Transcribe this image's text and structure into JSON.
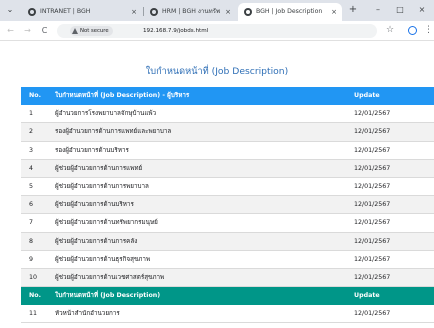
{
  "browser": {
    "tabs": [
      {
        "title": "INTRANET | BGH",
        "close": "×"
      },
      {
        "title": "HRM | BGH งานทรัพยากรมนุษย์",
        "close": "×"
      },
      {
        "title": "BGH | Job Description",
        "close": "×"
      }
    ],
    "new_tab": "+",
    "window_controls": {
      "minimize": "–",
      "maximize": "□",
      "close": "×"
    },
    "nav": {
      "back": "←",
      "forward": "→",
      "reload": "C"
    },
    "security_label": "Not secure",
    "url": "192.168.7.9/jobds.html",
    "star": "☆",
    "menu": "⋮"
  },
  "page": {
    "title": "ใบกำหนดหน้าที่ (Job Description)",
    "sections": [
      {
        "header": {
          "no": "No.",
          "title": "ใบกำหนดหน้าที่ (Job Description) - ผู้บริหาร",
          "update": "Update"
        },
        "rows": [
          {
            "no": "1",
            "title": "ผู้อำนวยการโรงพยาบาลจักษุบ้านแพ้ว",
            "update": "12/01/2567"
          },
          {
            "no": "2",
            "title": "รองผู้อำนวยการด้านการแพทย์และพยาบาล",
            "update": "12/01/2567"
          },
          {
            "no": "3",
            "title": "รองผู้อำนวยการด้านบริหาร",
            "update": "12/01/2567"
          },
          {
            "no": "4",
            "title": "ผู้ช่วยผู้อำนวยการด้านการแพทย์",
            "update": "12/01/2567"
          },
          {
            "no": "5",
            "title": "ผู้ช่วยผู้อำนวยการด้านการพยาบาล",
            "update": "12/01/2567"
          },
          {
            "no": "6",
            "title": "ผู้ช่วยผู้อำนวยการด้านบริหาร",
            "update": "12/01/2567"
          },
          {
            "no": "7",
            "title": "ผู้ช่วยผู้อำนวยการด้านทรัพยากรมนุษย์",
            "update": "12/01/2567"
          },
          {
            "no": "8",
            "title": "ผู้ช่วยผู้อำนวยการด้านการคลัง",
            "update": "12/01/2567"
          },
          {
            "no": "9",
            "title": "ผู้ช่วยผู้อำนวยการด้านธุรกิจสุขภาพ",
            "update": "12/01/2567"
          },
          {
            "no": "10",
            "title": "ผู้ช่วยผู้อำนวยการด้านเวชศาสตร์สุขภาพ",
            "update": "12/01/2567"
          }
        ]
      },
      {
        "header": {
          "no": "No.",
          "title": "ใบกำหนดหน้าที่ (Job Description)",
          "update": "Update"
        },
        "rows": [
          {
            "no": "11",
            "title": "หัวหน้าสำนักอำนวยการ",
            "update": "12/01/2567"
          }
        ]
      }
    ]
  },
  "colors": {
    "header_primary": "#2196f3",
    "header_secondary": "#009688",
    "title_text": "#2f6fb6",
    "row_alt": "#f2f2f2"
  }
}
